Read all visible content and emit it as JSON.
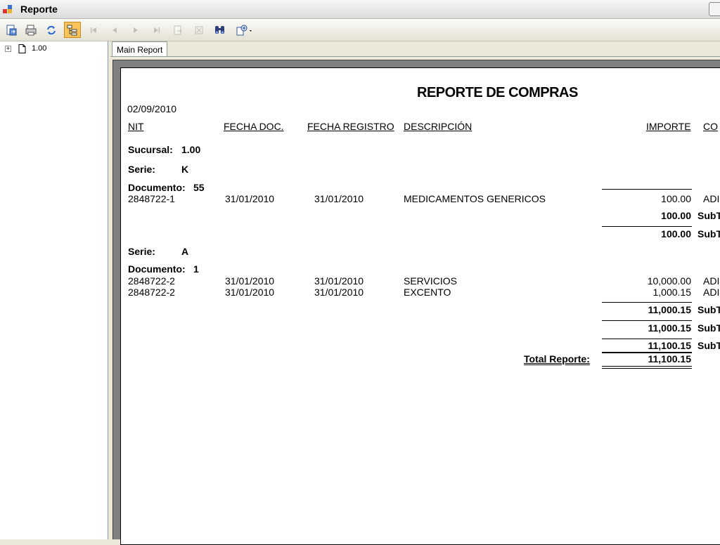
{
  "window": {
    "title": "Reporte"
  },
  "toolbar": {
    "buttons": [
      {
        "name": "export-icon",
        "enabled": true
      },
      {
        "name": "print-icon",
        "enabled": true
      },
      {
        "name": "refresh-icon",
        "enabled": true
      },
      {
        "name": "group-tree-icon",
        "enabled": true,
        "active": true
      },
      {
        "name": "first-page-icon",
        "enabled": false
      },
      {
        "name": "previous-page-icon",
        "enabled": false
      },
      {
        "name": "next-page-icon",
        "enabled": false
      },
      {
        "name": "last-page-icon",
        "enabled": false
      },
      {
        "name": "goto-page-icon",
        "enabled": false
      },
      {
        "name": "stop-icon",
        "enabled": false
      },
      {
        "name": "search-icon",
        "enabled": true
      },
      {
        "name": "zoom-icon",
        "enabled": true
      }
    ]
  },
  "tree": {
    "items": [
      {
        "label": "1.00",
        "expander": "+"
      }
    ]
  },
  "tabs": [
    {
      "label": "Main Report"
    }
  ],
  "report": {
    "title": "REPORTE DE COMPRAS",
    "date": "02/09/2010",
    "columns": {
      "nit": "NIT",
      "fecha_doc": "FECHA DOC.",
      "fecha_registro": "FECHA REGISTRO",
      "descripcion": "DESCRIPCIÓN",
      "importe": "IMPORTE",
      "co": "CO"
    },
    "sucursal": {
      "label": "Sucursal:",
      "value": "1.00"
    },
    "serie_k": {
      "label": "Serie:",
      "value": "K"
    },
    "doc_55": {
      "label": "Documento:",
      "value": "55"
    },
    "rows_k": [
      {
        "nit": "2848722-1",
        "fecha_doc": "31/01/2010",
        "fecha_registro": "31/01/2010",
        "descripcion": "MEDICAMENTOS GENERICOS",
        "importe": "100.00",
        "tail": "ADI"
      }
    ],
    "subtotal_doc_55": {
      "value": "100.00",
      "label": "SubT"
    },
    "subtotal_serie_k": {
      "value": "100.00",
      "label": "SubT"
    },
    "serie_a": {
      "label": "Serie:",
      "value": "A"
    },
    "doc_1": {
      "label": "Documento:",
      "value": "1"
    },
    "rows_a": [
      {
        "nit": "2848722-2",
        "fecha_doc": "31/01/2010",
        "fecha_registro": "31/01/2010",
        "descripcion": "SERVICIOS",
        "importe": "10,000.00",
        "tail": "ADI"
      },
      {
        "nit": "2848722-2",
        "fecha_doc": "31/01/2010",
        "fecha_registro": "31/01/2010",
        "descripcion": "EXCENTO",
        "importe": "1,000.15",
        "tail": "ADI"
      }
    ],
    "subtotal_doc_1": {
      "value": "11,000.15",
      "label": "SubT"
    },
    "subtotal_serie_a": {
      "value": "11,000.15",
      "label": "SubT"
    },
    "subtotal_sucursal": {
      "value": "11,100.15",
      "label": "SubT"
    },
    "total": {
      "label": "Total Reporte:",
      "value": "11,100.15"
    }
  }
}
